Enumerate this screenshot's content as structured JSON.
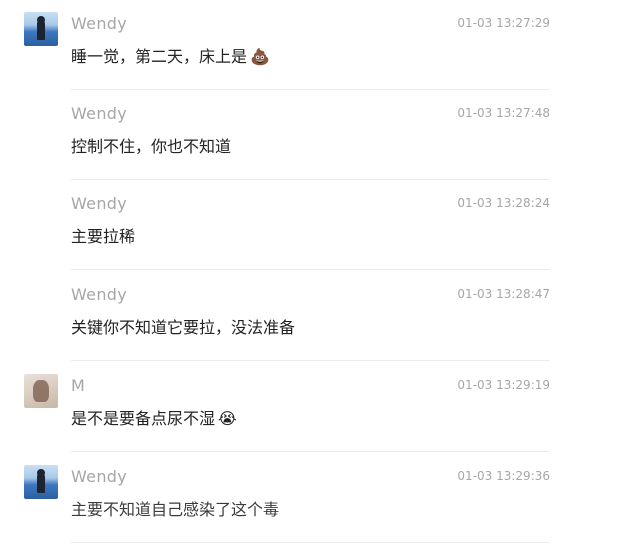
{
  "messages": [
    {
      "sender": "Wendy",
      "time": "01-03 13:27:29",
      "text": "睡一觉，第二天，床上是",
      "emoji": "💩",
      "avatar": "beach-avatar-icon"
    },
    {
      "sender": "Wendy",
      "time": "01-03 13:27:48",
      "text": "控制不住，你也不知道"
    },
    {
      "sender": "Wendy",
      "time": "01-03 13:28:24",
      "text": "主要拉稀"
    },
    {
      "sender": "Wendy",
      "time": "01-03 13:28:47",
      "text": "关键你不知道它要拉，没法准备"
    },
    {
      "sender": "M",
      "time": "01-03 13:29:19",
      "text": "是不是要备点尿不湿",
      "emoji": "😭",
      "avatar": "photo-avatar-icon"
    },
    {
      "sender": "Wendy",
      "time": "01-03 13:29:36",
      "text": "主要不知道自己感染了这个毒",
      "avatar": "beach-avatar-icon"
    }
  ]
}
